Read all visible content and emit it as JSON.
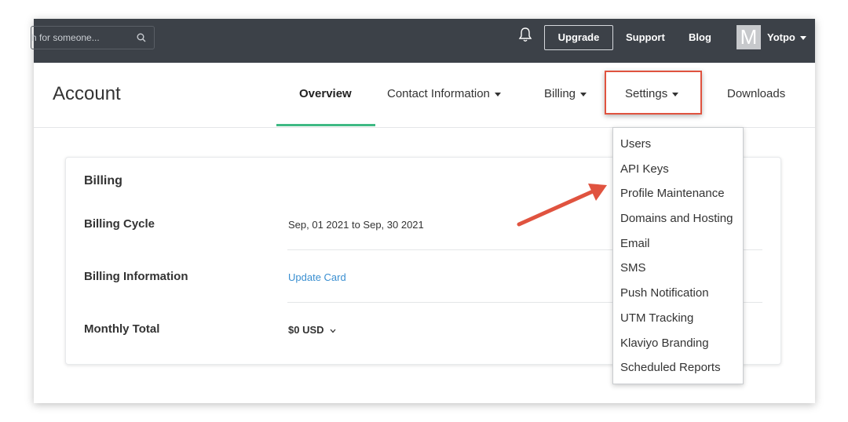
{
  "topbar": {
    "search_placeholder": "h for someone...",
    "upgrade_label": "Upgrade",
    "support_label": "Support",
    "blog_label": "Blog",
    "avatar_letter": "M",
    "user_name": "Yotpo"
  },
  "header": {
    "title": "Account",
    "tabs": [
      {
        "label": "Overview",
        "active": true
      },
      {
        "label": "Contact Information"
      },
      {
        "label": "Billing"
      },
      {
        "label": "Settings"
      },
      {
        "label": "Downloads"
      }
    ]
  },
  "billing": {
    "title": "Billing",
    "rows": [
      {
        "label": "Billing Cycle",
        "value": "Sep, 01 2021 to Sep, 30 2021"
      },
      {
        "label": "Billing Information",
        "value": "Update Card"
      },
      {
        "label": "Monthly Total",
        "value": "$0 USD"
      }
    ]
  },
  "settings_menu": {
    "items": [
      "Users",
      "API Keys",
      "Profile Maintenance",
      "Domains and Hosting",
      "Email",
      "SMS",
      "Push Notification",
      "UTM Tracking",
      "Klaviyo Branding",
      "Scheduled Reports"
    ]
  },
  "colors": {
    "topbar": "#3c4148",
    "accent_green": "#3fb984",
    "highlight_red": "#e0533f",
    "link_blue": "#3a8fd1"
  }
}
